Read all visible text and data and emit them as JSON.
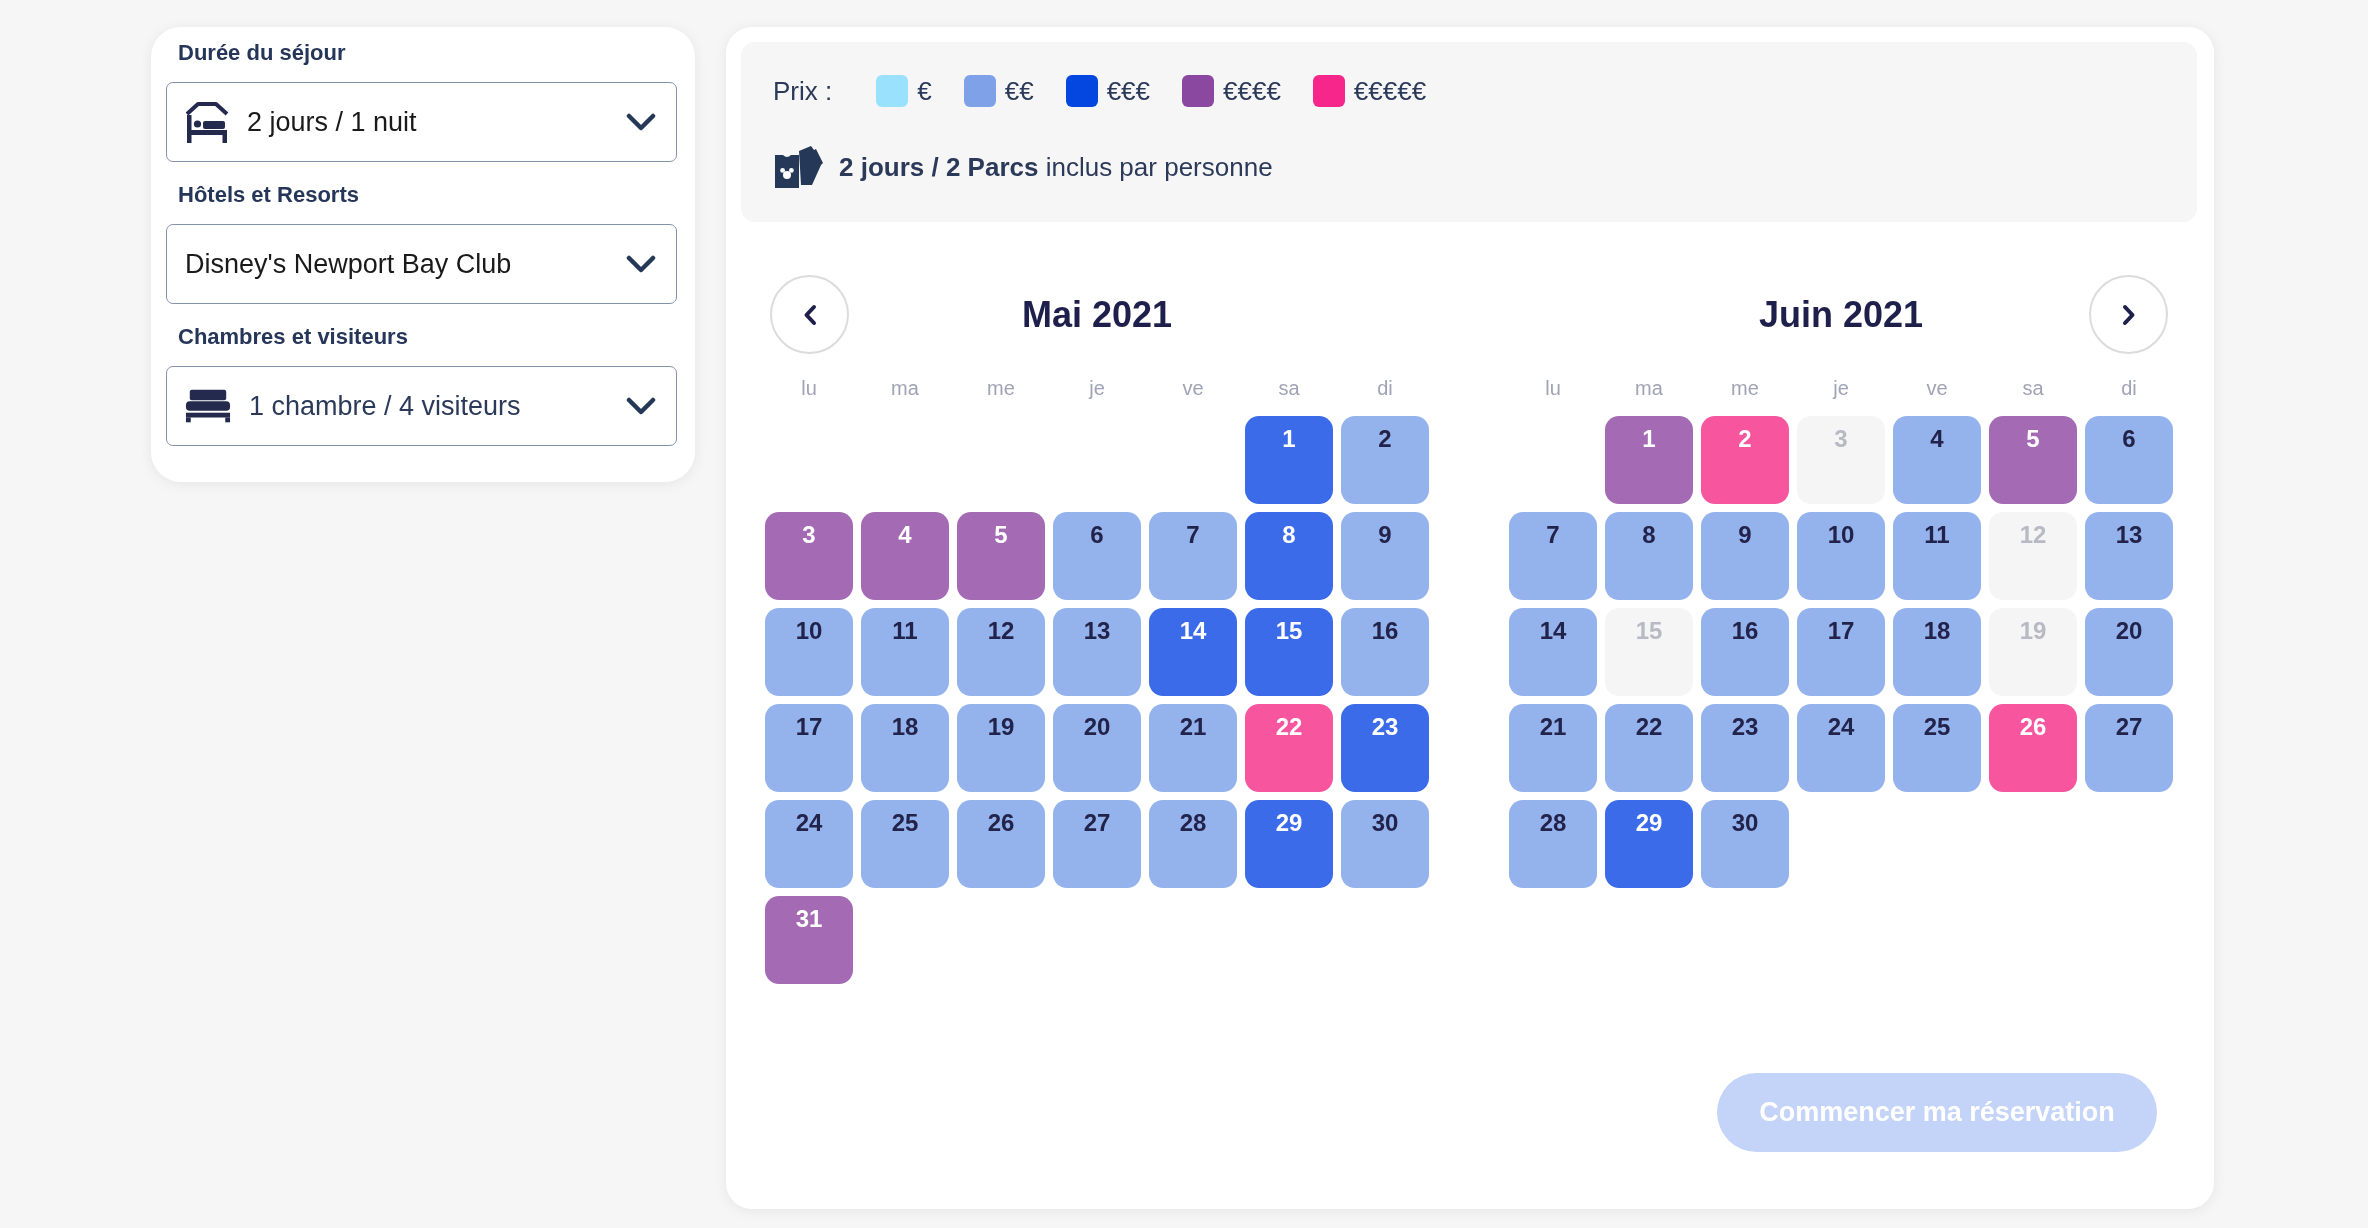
{
  "filters": [
    {
      "kind": "duration",
      "label": "Durée du séjour",
      "value": "2 jours / 1 nuit"
    },
    {
      "kind": "hotel",
      "label": "Hôtels et Resorts",
      "value": "Disney's Newport Bay Club"
    },
    {
      "kind": "rooms",
      "label": "Chambres et visiteurs",
      "value": "1 chambre / 4 visiteurs"
    }
  ],
  "legend": {
    "title": "Prix :",
    "items": [
      {
        "label": "€",
        "color": "#99e1fc"
      },
      {
        "label": "€€",
        "color": "#7ea1e8"
      },
      {
        "label": "€€€",
        "color": "#0447e0"
      },
      {
        "label": "€€€€",
        "color": "#8b48a0"
      },
      {
        "label": "€€€€€",
        "color": "#f7268a"
      }
    ],
    "info": "**2 jours / 2 Parcs** inclus par personne"
  },
  "months": [
    {
      "title": "Mai 2021",
      "weekdays": [
        "lu",
        "ma",
        "me",
        "je",
        "ve",
        "sa",
        "di"
      ],
      "weeks": [
        [
          {
            "day": "1",
            "available": true,
            "color": "#3b6be8"
          },
          {
            "day": "2",
            "available": true,
            "color": "#94b2ec"
          }
        ],
        [
          {
            "day": "3",
            "available": true,
            "color": "#a46bb4"
          },
          {
            "day": "4",
            "available": true,
            "color": "#a46bb4"
          },
          {
            "day": "5",
            "available": true,
            "color": "#a46bb4"
          },
          {
            "day": "6",
            "available": true,
            "color": "#94b2ec"
          },
          {
            "day": "7",
            "available": true,
            "color": "#94b2ec"
          },
          {
            "day": "8",
            "available": true,
            "color": "#3b6be8"
          },
          {
            "day": "9",
            "available": true,
            "color": "#94b2ec"
          }
        ],
        [
          {
            "day": "10",
            "available": true,
            "color": "#94b2ec"
          },
          {
            "day": "11",
            "available": true,
            "color": "#94b2ec"
          },
          {
            "day": "12",
            "available": true,
            "color": "#94b2ec"
          },
          {
            "day": "13",
            "available": true,
            "color": "#94b2ec"
          },
          {
            "day": "14",
            "available": true,
            "color": "#3b6be8"
          },
          {
            "day": "15",
            "available": true,
            "color": "#3b6be8"
          },
          {
            "day": "16",
            "available": true,
            "color": "#94b2ec"
          }
        ],
        [
          {
            "day": "17",
            "available": true,
            "color": "#94b2ec"
          },
          {
            "day": "18",
            "available": true,
            "color": "#94b2ec"
          },
          {
            "day": "19",
            "available": true,
            "color": "#94b2ec"
          },
          {
            "day": "20",
            "available": true,
            "color": "#94b2ec"
          },
          {
            "day": "21",
            "available": true,
            "color": "#94b2ec"
          },
          {
            "day": "22",
            "available": true,
            "color": "#f7559e"
          },
          {
            "day": "23",
            "available": true,
            "color": "#3b6be8"
          }
        ],
        [
          {
            "day": "24",
            "available": true,
            "color": "#94b2ec"
          },
          {
            "day": "25",
            "available": true,
            "color": "#94b2ec"
          },
          {
            "day": "26",
            "available": true,
            "color": "#94b2ec"
          },
          {
            "day": "27",
            "available": true,
            "color": "#94b2ec"
          },
          {
            "day": "28",
            "available": true,
            "color": "#94b2ec"
          },
          {
            "day": "29",
            "available": true,
            "color": "#3b6be8"
          },
          {
            "day": "30",
            "available": true,
            "color": "#94b2ec"
          }
        ],
        [
          {
            "day": "31",
            "available": true,
            "color": "#a46bb4"
          }
        ]
      ]
    },
    {
      "title": "Juin 2021",
      "weekdays": [
        "lu",
        "ma",
        "me",
        "je",
        "ve",
        "sa",
        "di"
      ],
      "weeks": [
        [
          {
            "day": "1",
            "available": true,
            "color": "#a46bb4"
          },
          {
            "day": "2",
            "available": true,
            "color": "#f7559e"
          },
          {
            "day": "3",
            "available": false
          },
          {
            "day": "4",
            "available": true,
            "color": "#94b2ec"
          },
          {
            "day": "5",
            "available": true,
            "color": "#a46bb4"
          },
          {
            "day": "6",
            "available": true,
            "color": "#94b2ec"
          }
        ],
        [
          {
            "day": "7",
            "available": true,
            "color": "#94b2ec"
          },
          {
            "day": "8",
            "available": true,
            "color": "#94b2ec"
          },
          {
            "day": "9",
            "available": true,
            "color": "#94b2ec"
          },
          {
            "day": "10",
            "available": true,
            "color": "#94b2ec"
          },
          {
            "day": "11",
            "available": true,
            "color": "#94b2ec"
          },
          {
            "day": "12",
            "available": false
          },
          {
            "day": "13",
            "available": true,
            "color": "#94b2ec"
          }
        ],
        [
          {
            "day": "14",
            "available": true,
            "color": "#94b2ec"
          },
          {
            "day": "15",
            "available": false
          },
          {
            "day": "16",
            "available": true,
            "color": "#94b2ec"
          },
          {
            "day": "17",
            "available": true,
            "color": "#94b2ec"
          },
          {
            "day": "18",
            "available": true,
            "color": "#94b2ec"
          },
          {
            "day": "19",
            "available": false
          },
          {
            "day": "20",
            "available": true,
            "color": "#94b2ec"
          }
        ],
        [
          {
            "day": "21",
            "available": true,
            "color": "#94b2ec"
          },
          {
            "day": "22",
            "available": true,
            "color": "#94b2ec"
          },
          {
            "day": "23",
            "available": true,
            "color": "#94b2ec"
          },
          {
            "day": "24",
            "available": true,
            "color": "#94b2ec"
          },
          {
            "day": "25",
            "available": true,
            "color": "#94b2ec"
          },
          {
            "day": "26",
            "available": true,
            "color": "#f7559e"
          },
          {
            "day": "27",
            "available": true,
            "color": "#94b2ec"
          }
        ],
        [
          {
            "day": "28",
            "available": true,
            "color": "#94b2ec"
          },
          {
            "day": "29",
            "available": true,
            "color": "#3b6be8"
          },
          {
            "day": "30",
            "available": true,
            "color": "#94b2ec"
          }
        ]
      ]
    }
  ],
  "button": {
    "label": "Commencer ma réservation",
    "disabled": true
  }
}
